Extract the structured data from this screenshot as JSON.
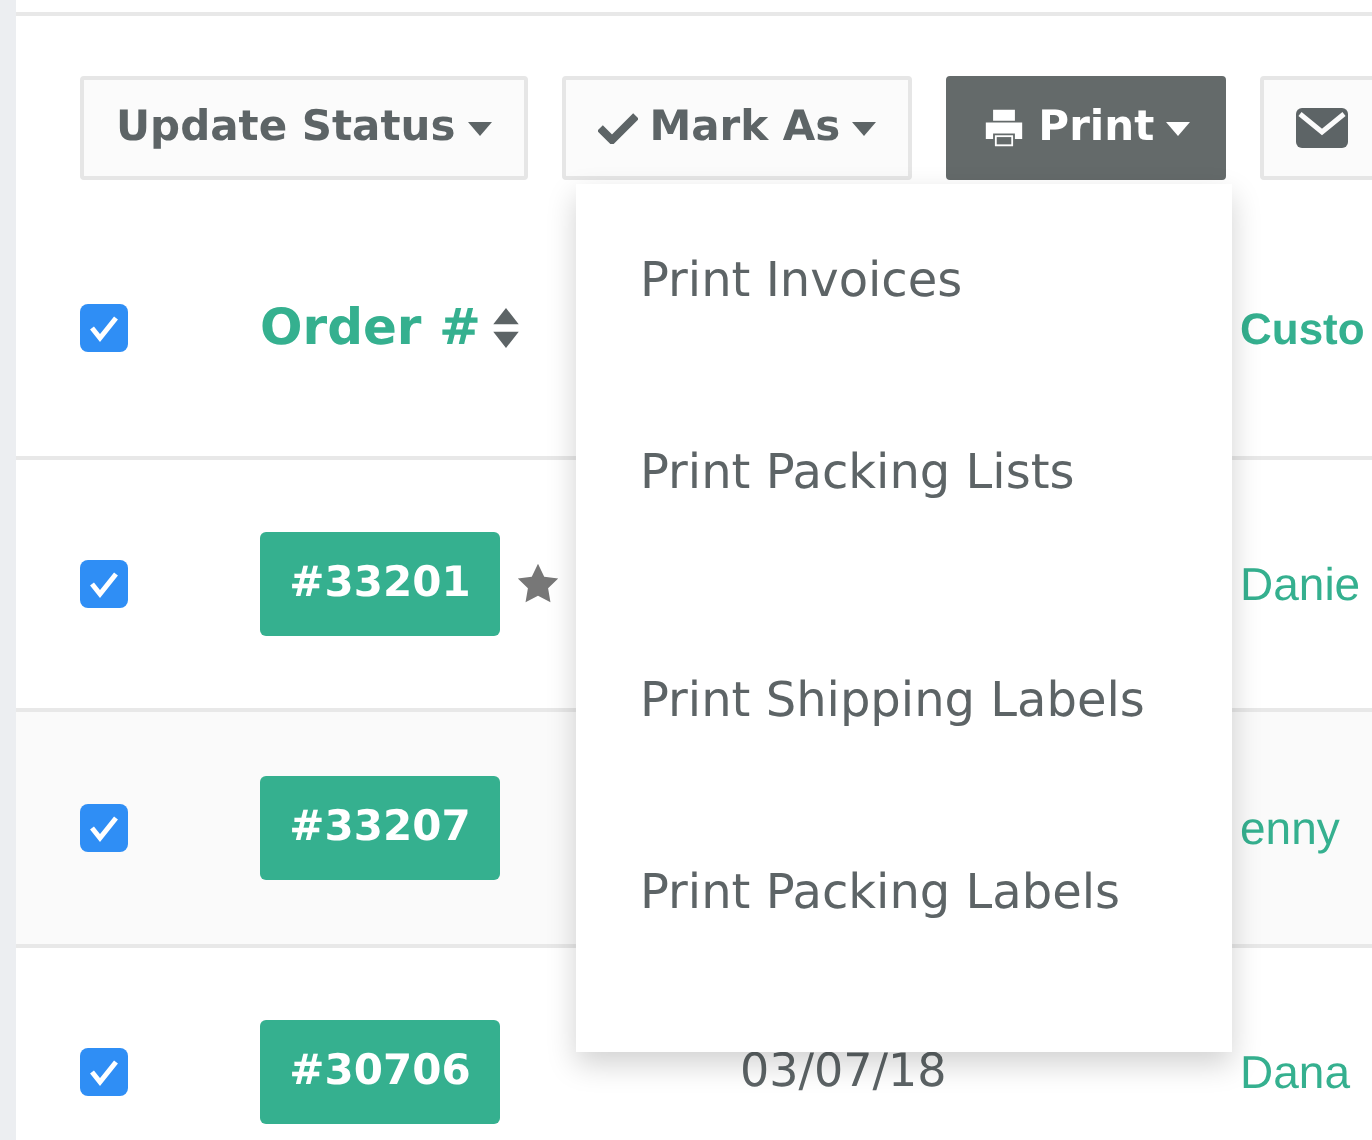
{
  "toolbar": [
    {
      "kind": "plain",
      "label": "Update Status",
      "expanded": false
    },
    {
      "kind": "check",
      "label": "Mark As",
      "expanded": false
    },
    {
      "kind": "print",
      "label": "Print",
      "expanded": true,
      "menu": [
        "Print Invoices",
        "Print Packing Lists",
        "Print Shipping Labels",
        "Print Packing Labels"
      ]
    },
    {
      "kind": "mail",
      "expanded": false
    }
  ],
  "table": {
    "select_all": {
      "checked": true
    },
    "columns": [
      {
        "label": "Order #",
        "sortable": true
      },
      {
        "label": "Custo",
        "sortable": false
      }
    ],
    "rows": [
      {
        "checked": true,
        "order": "#33201",
        "starred": true,
        "customer": "Danie"
      },
      {
        "checked": true,
        "order": "#33207",
        "starred": false,
        "customer": "enny"
      },
      {
        "checked": true,
        "order": "#30706",
        "starred": false,
        "date": "03/07/18",
        "customer": "Dana"
      }
    ]
  }
}
